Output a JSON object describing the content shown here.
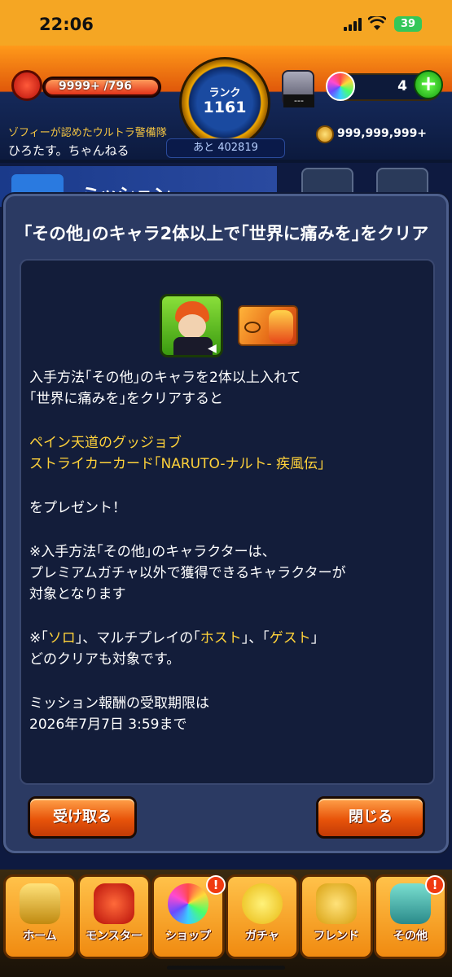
{
  "status_bar": {
    "time": "22:06",
    "battery": "39"
  },
  "hud": {
    "stamina": "9999+ /796",
    "rank_label": "ランク",
    "rank_value": "1161",
    "rank_next": "あと 402819",
    "ticket_label": "---",
    "orb_count": "4",
    "player_title": "ゾフィーが認めたウルトラ警備隊",
    "player_name": "ひろたす。ちゃんねる",
    "coins": "999,999,999+"
  },
  "background": {
    "screen_title": "ミッション"
  },
  "dialog": {
    "title": "｢その他｣のキャラ2体以上で｢世界に痛みを｣をクリア",
    "body": {
      "line1": "入手方法｢その他｣のキャラを2体以上入れて",
      "line2": "｢世界に痛みを｣をクリアすると",
      "reward1": "ペイン天道のグッジョブ",
      "reward2": "ストライカーカード｢NARUTO-ナルト- 疾風伝｣",
      "present": "をプレゼント！",
      "note1a": "※入手方法｢その他｣のキャラクターは、",
      "note1b": "プレミアムガチャ以外で獲得できるキャラクターが",
      "note1c": "対象となります",
      "note2_prefix": "※｢",
      "note2_solo": "ソロ",
      "note2_mid1": "｣、マルチプレイの｢",
      "note2_host": "ホスト",
      "note2_mid2": "｣、｢",
      "note2_guest": "ゲスト",
      "note2_suffix": "｣",
      "note2b": "どのクリアも対象です。",
      "deadline1": "ミッション報酬の受取期限は",
      "deadline2": "2026年7月7日 3:59まで"
    },
    "receive_button": "受け取る",
    "close_button": "閉じる"
  },
  "bottom_nav": {
    "items": [
      {
        "label": "ホーム"
      },
      {
        "label": "モンスター"
      },
      {
        "label": "ショップ",
        "badge": "!"
      },
      {
        "label": "ガチャ"
      },
      {
        "label": "フレンド"
      },
      {
        "label": "その他",
        "badge": "!"
      }
    ]
  },
  "colors": {
    "accent_orange": "#e8540a",
    "gold_text": "#ffd23a",
    "dialog_bg": "#2b3a63"
  }
}
